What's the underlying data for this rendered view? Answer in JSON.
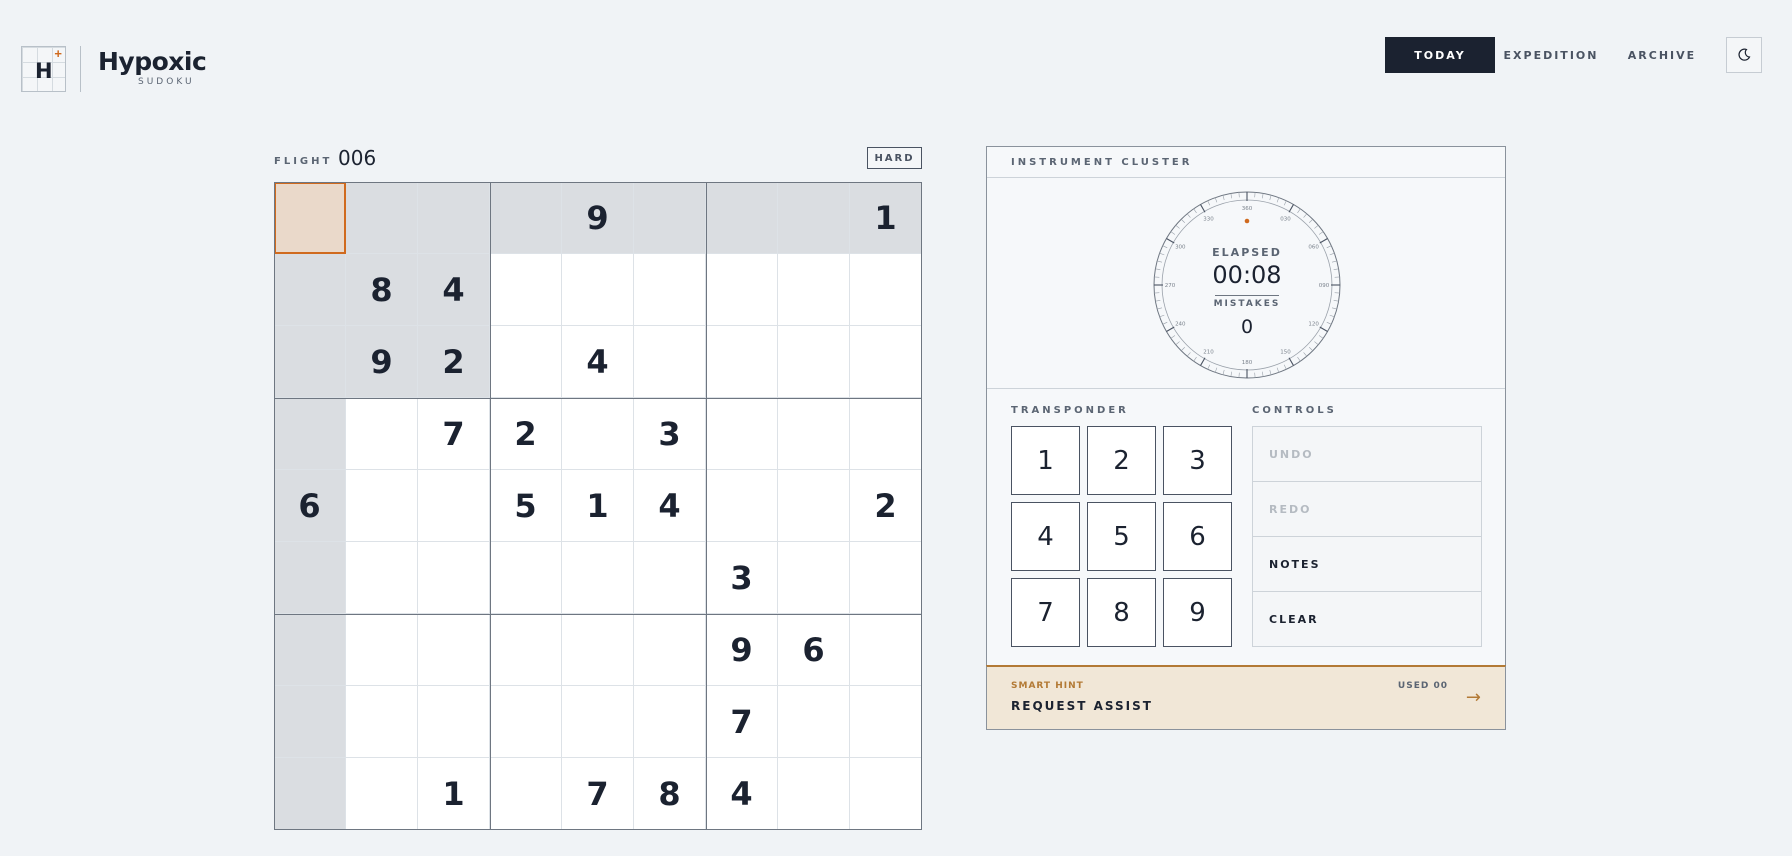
{
  "brand": {
    "logo_letter": "H",
    "logo_mark": "+",
    "title": "Hypoxic",
    "subtitle": "SUDOKU"
  },
  "nav": {
    "tabs": [
      {
        "label": "TODAY",
        "active": true
      },
      {
        "label": "EXPEDITION",
        "active": false
      },
      {
        "label": "ARCHIVE",
        "active": false
      }
    ],
    "theme_icon": "moon-icon"
  },
  "puzzle": {
    "flight_label": "FLIGHT",
    "flight_number": "006",
    "difficulty": "HARD",
    "selected": [
      0,
      0
    ],
    "grid": [
      [
        "",
        "",
        "",
        "",
        "9",
        "",
        "",
        "",
        "1"
      ],
      [
        "",
        "8",
        "4",
        "",
        "",
        "",
        "",
        "",
        ""
      ],
      [
        "",
        "9",
        "2",
        "",
        "4",
        "",
        "",
        "",
        ""
      ],
      [
        "",
        "",
        "7",
        "2",
        "",
        "3",
        "",
        "",
        ""
      ],
      [
        "6",
        "",
        "",
        "5",
        "1",
        "4",
        "",
        "",
        "2"
      ],
      [
        "",
        "",
        "",
        "",
        "",
        "",
        "3",
        "",
        ""
      ],
      [
        "",
        "",
        "",
        "",
        "",
        "",
        "9",
        "6",
        ""
      ],
      [
        "",
        "",
        "",
        "",
        "",
        "",
        "7",
        "",
        ""
      ],
      [
        "",
        "",
        "1",
        "",
        "7",
        "8",
        "4",
        "",
        ""
      ]
    ]
  },
  "instruments": {
    "header": "INSTRUMENT CLUSTER",
    "elapsed_label": "ELAPSED",
    "elapsed": "00:08",
    "mistakes_label": "MISTAKES",
    "mistakes": "0",
    "dial_labels": [
      "360",
      "030",
      "060",
      "090",
      "120",
      "150",
      "180",
      "210",
      "240",
      "270",
      "300",
      "330"
    ]
  },
  "transponder": {
    "label": "TRANSPONDER",
    "keys": [
      "1",
      "2",
      "3",
      "4",
      "5",
      "6",
      "7",
      "8",
      "9"
    ]
  },
  "controls": {
    "label": "CONTROLS",
    "items": [
      {
        "label": "UNDO",
        "enabled": false
      },
      {
        "label": "REDO",
        "enabled": false
      },
      {
        "label": "NOTES",
        "enabled": true
      },
      {
        "label": "CLEAR",
        "enabled": true
      }
    ]
  },
  "hint": {
    "label": "SMART HINT",
    "title": "REQUEST ASSIST",
    "used": "USED 00",
    "arrow": "→"
  },
  "colors": {
    "accent": "#d06a1e",
    "ink": "#1b2230",
    "hint_bg": "#f1e7d7",
    "hint_accent": "#b37a35",
    "highlight": "#dadde1",
    "selected": "#ead9ca"
  }
}
